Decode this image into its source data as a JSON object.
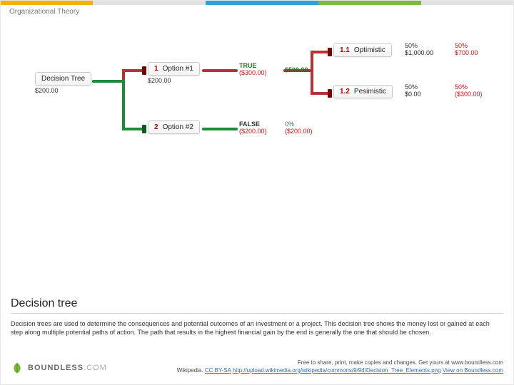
{
  "brand_stripe": [
    "#f2b200",
    "#e2e2e2",
    "#2aa3d9",
    "#7db93d",
    "#e2e2e2"
  ],
  "breadcrumb": "Organizational Theory",
  "tree": {
    "root": {
      "label": "Decision Tree",
      "sub": "$200.00"
    },
    "opt1": {
      "num": "1",
      "label": "Option #1",
      "sub": "$200.00",
      "flag": "TRUE",
      "flag_val": "($300.00)",
      "result": "$500.00"
    },
    "opt2": {
      "num": "2",
      "label": "Option #2",
      "sub": "",
      "flag": "FALSE",
      "flag_val": "($200.00)",
      "result_pct": "0%",
      "result_val": "($200.00)"
    },
    "leaf_opt": {
      "num": "1.1",
      "label": "Optimistic",
      "pct1": "50%",
      "val1": "$1,000.00",
      "pct2": "50%",
      "val2": "$700.00"
    },
    "leaf_pes": {
      "num": "1.2",
      "label": "Pesimistic",
      "pct1": "50%",
      "val1": "$0.00",
      "pct2": "50%",
      "val2": "($300.00)"
    }
  },
  "footer": {
    "title": "Decision tree",
    "desc": "Decision trees are used to determine the consequences and potential outcomes of an investment or a project. This decision tree shows the money lost or gained at each step along multiple potential paths of action. The path that results in the highest financial gain by the end is generally the one that should be chosen.",
    "share_line": "Free to share, print, make copies and changes. Get yours at www.boundless.com",
    "source_prefix": "Wikipedia.",
    "license": "CC BY-SA",
    "src_url": "http://upload.wikimedia.org/wikipedia/commons/9/94/Decision_Tree_Elements.png",
    "view_on": "View on Boundless.com",
    "brand": {
      "word1": "BOUNDLESS",
      "word2": ".COM"
    }
  }
}
